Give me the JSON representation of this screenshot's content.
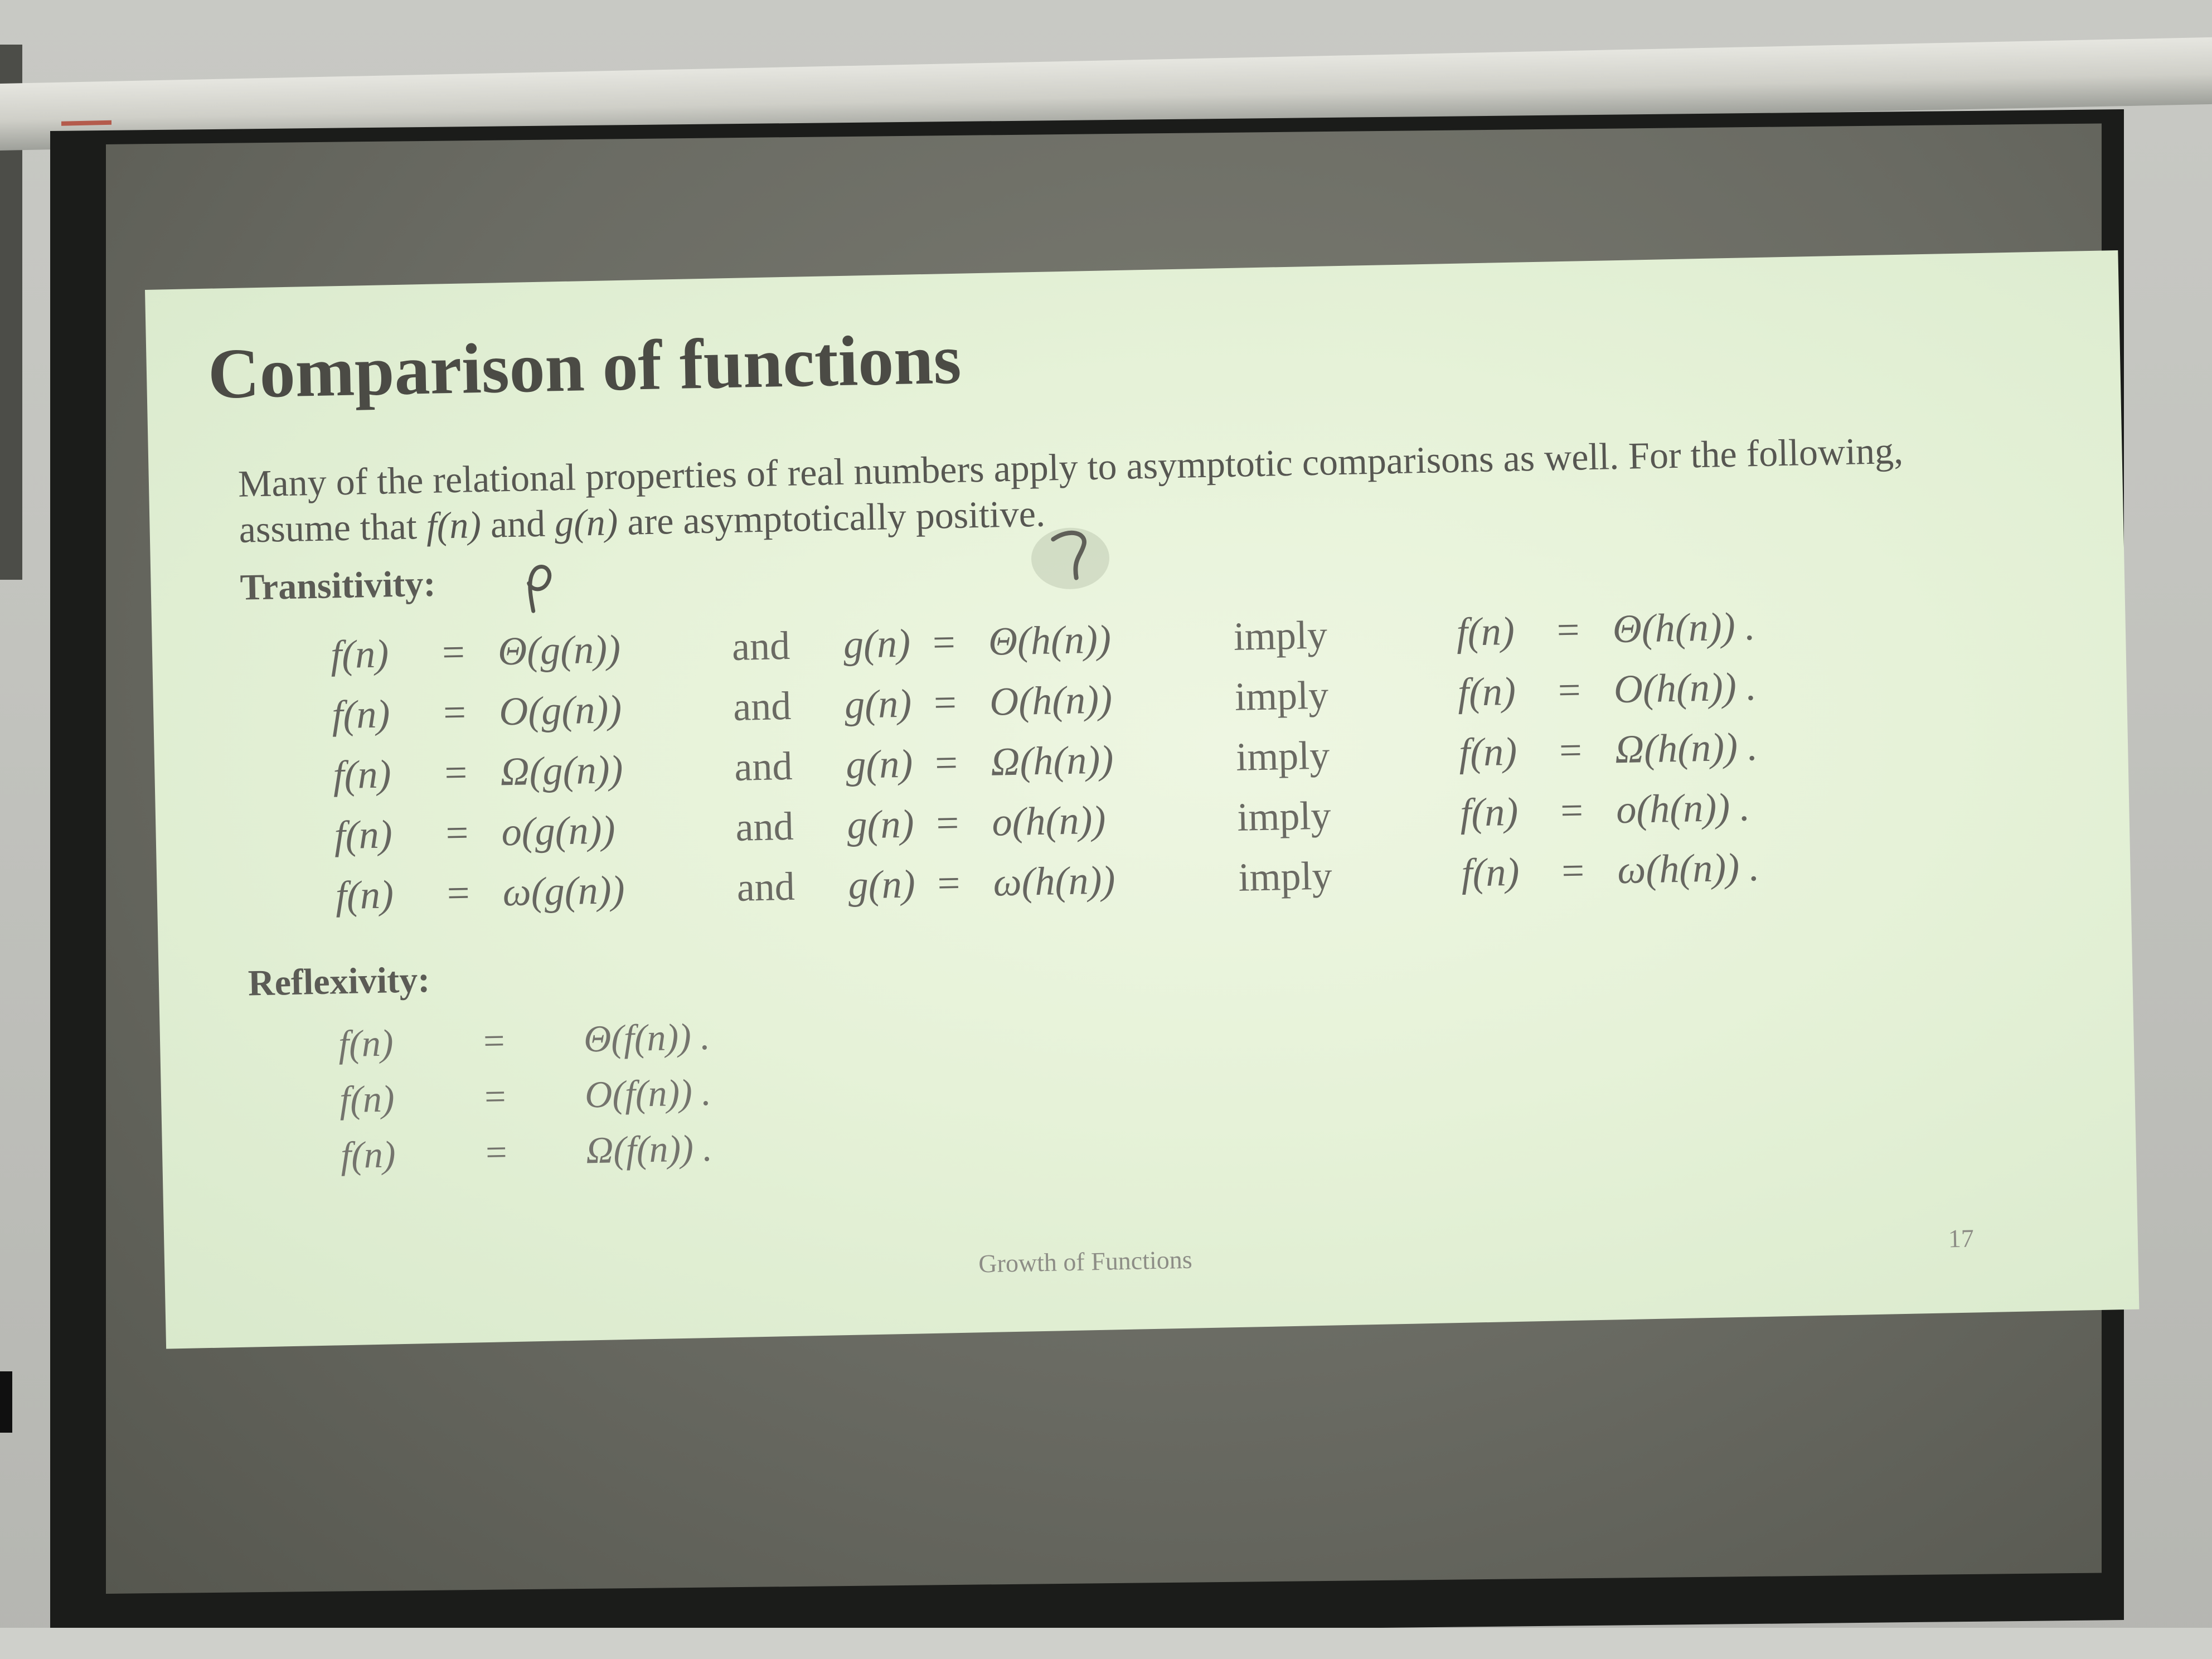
{
  "slide": {
    "title": "Comparison of functions",
    "intro_part1": "Many of the relational properties of real numbers apply to asymptotic comparisons as well. For the following, assume that",
    "intro_f": "f(n)",
    "intro_and": "and",
    "intro_g": "g(n)",
    "intro_part2": "are asymptotically positive.",
    "transitivity_heading": "Transitivity:",
    "transitivity_rows": [
      {
        "lhs": "f(n)",
        "eq1": "=",
        "mid": "Θ(g(n))",
        "and": "and",
        "g": "g(n)",
        "eq2": "=",
        "r1": "Θ(h(n))",
        "imply": "imply",
        "f2": "f(n)",
        "eq3": "=",
        "r2": "Θ(h(n)) ."
      },
      {
        "lhs": "f(n)",
        "eq1": "=",
        "mid": "O(g(n))",
        "and": "and",
        "g": "g(n)",
        "eq2": "=",
        "r1": "O(h(n))",
        "imply": "imply",
        "f2": "f(n)",
        "eq3": "=",
        "r2": "O(h(n)) ."
      },
      {
        "lhs": "f(n)",
        "eq1": "=",
        "mid": "Ω(g(n))",
        "and": "and",
        "g": "g(n)",
        "eq2": "=",
        "r1": "Ω(h(n))",
        "imply": "imply",
        "f2": "f(n)",
        "eq3": "=",
        "r2": "Ω(h(n)) ."
      },
      {
        "lhs": "f(n)",
        "eq1": "=",
        "mid": "o(g(n))",
        "and": "and",
        "g": "g(n)",
        "eq2": "=",
        "r1": "o(h(n))",
        "imply": "imply",
        "f2": "f(n)",
        "eq3": "=",
        "r2": "o(h(n)) ."
      },
      {
        "lhs": "f(n)",
        "eq1": "=",
        "mid": "ω(g(n))",
        "and": "and",
        "g": "g(n)",
        "eq2": "=",
        "r1": "ω(h(n))",
        "imply": "imply",
        "f2": "f(n)",
        "eq3": "=",
        "r2": "ω(h(n)) ."
      }
    ],
    "reflexivity_heading": "Reflexivity:",
    "reflexivity_rows": [
      {
        "lhs": "f(n)",
        "eq": "=",
        "rhs": "Θ(f(n)) ."
      },
      {
        "lhs": "f(n)",
        "eq": "=",
        "rhs": "O(f(n)) ."
      },
      {
        "lhs": "f(n)",
        "eq": "=",
        "rhs": "Ω(f(n)) ."
      }
    ],
    "footer": "Growth of Functions",
    "page_number": "17"
  }
}
